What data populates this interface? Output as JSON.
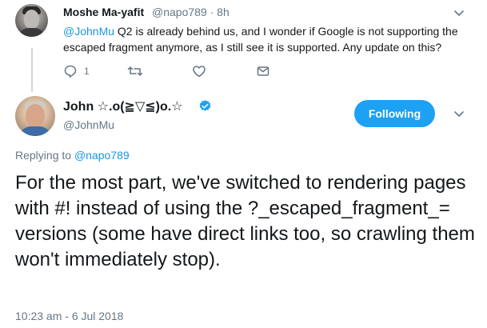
{
  "parent_tweet": {
    "author_name": "Moshe Ma-yafit",
    "handle_time": "@napo789 · 8h",
    "mention": "@JohnMu",
    "text": " Q2 is already behind us, and I wonder if Google is not supporting the escaped fragment anymore, as I still see it is supported. Any update on this?",
    "reply_count": "1",
    "icons": [
      "reply-icon",
      "retweet-icon",
      "like-icon",
      "direct-message-icon",
      "chevron-down-icon"
    ]
  },
  "main_tweet": {
    "author_name": "John ☆.o(≧▽≦)o.☆",
    "handle": "@JohnMu",
    "follow_label": "Following",
    "replying_prefix": "Replying to ",
    "replying_mention": "@napo789",
    "text": "For the most part, we've switched to rendering pages with #! instead of using the ?_escaped_fragment_= versions (some have direct links too, so crawling them won't immediately stop).",
    "timestamp": "10:23 am - 6 Jul 2018",
    "icons": [
      "verified-badge-icon",
      "chevron-down-icon"
    ]
  },
  "colors": {
    "accent": "#1da1f2",
    "link": "#1b95e0",
    "secondary_text": "#657786",
    "primary_text": "#14171a"
  }
}
